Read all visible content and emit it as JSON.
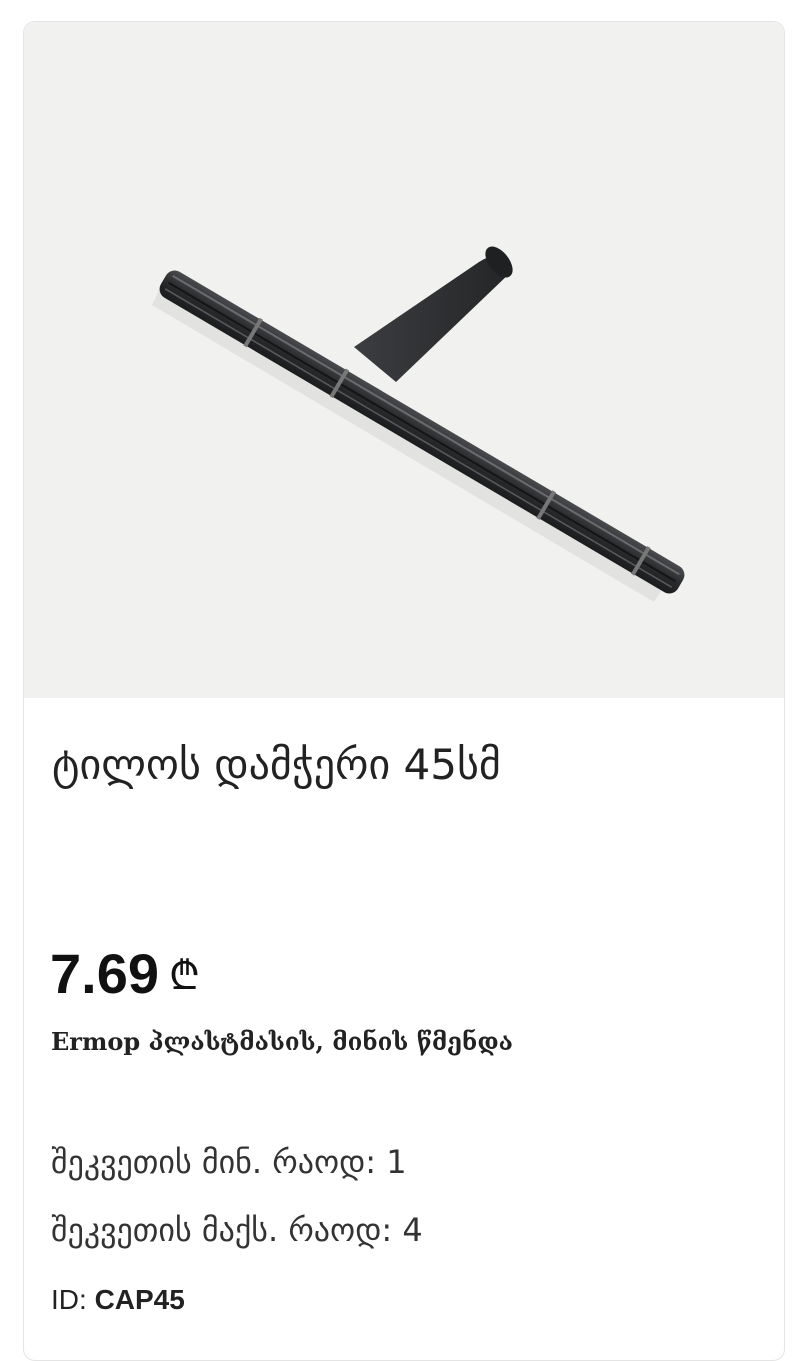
{
  "product": {
    "title": "ტილოს დამჭერი 45სმ",
    "price_value": "7.69",
    "currency_symbol": "₾",
    "subtitle": "Ermop პლასტმასის, მინის წმენდა",
    "order_min": "შეკვეთის მინ. რაოდ: 1",
    "order_max": "შეკვეთის მაქს. რაოდ: 4",
    "id_label": "ID:",
    "id_value": "CAP45",
    "image_icon": "window-squeegee-handle-image"
  },
  "colors": {
    "image_background": "#f1f1ef",
    "product_color": "#2a2b2d",
    "card_border": "#e4e4e4"
  }
}
